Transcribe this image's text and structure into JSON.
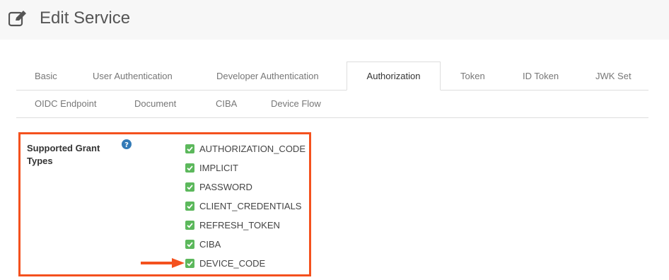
{
  "header": {
    "title": "Edit Service",
    "icon": "edit-icon"
  },
  "tabs": [
    {
      "label": "Basic"
    },
    {
      "label": "User Authentication"
    },
    {
      "label": "Developer Authentication"
    },
    {
      "label": "Authorization",
      "active": true
    },
    {
      "label": "Token"
    },
    {
      "label": "ID Token"
    },
    {
      "label": "JWK Set"
    },
    {
      "label": "OIDC Endpoint"
    },
    {
      "label": "Document"
    },
    {
      "label": "CIBA"
    },
    {
      "label": "Device Flow"
    }
  ],
  "field": {
    "label": "Supported Grant Types",
    "grant_types": [
      {
        "label": "AUTHORIZATION_CODE",
        "checked": true
      },
      {
        "label": "IMPLICIT",
        "checked": true
      },
      {
        "label": "PASSWORD",
        "checked": true
      },
      {
        "label": "CLIENT_CREDENTIALS",
        "checked": true
      },
      {
        "label": "REFRESH_TOKEN",
        "checked": true
      },
      {
        "label": "CIBA",
        "checked": true
      },
      {
        "label": "DEVICE_CODE",
        "checked": true
      }
    ]
  },
  "colors": {
    "highlight": "#f4511e",
    "checkbox": "#5cb85c",
    "help": "#337ab7"
  }
}
